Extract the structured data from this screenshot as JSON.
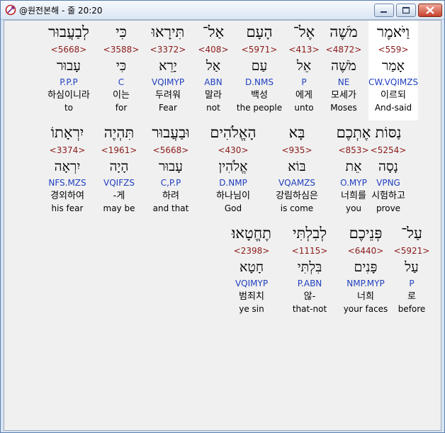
{
  "window": {
    "title": "@원전본해 - 줄 20:20"
  },
  "rows": [
    [
      {
        "heb": "וַיֹּאמֶר",
        "num": "<559>",
        "lemma": "אָמַר",
        "code": "CW.VQIMZS",
        "kor": "이르되",
        "eng": "And-said",
        "highlight": true
      },
      {
        "heb": "מֹשֶׁה",
        "num": "<4872>",
        "lemma": "מֹשֶׁה",
        "code": "NE",
        "kor": "모세가",
        "eng": "Moses"
      },
      {
        "heb": "אֶל־",
        "num": "<413>",
        "lemma": "אֵל",
        "code": "P",
        "kor": "에게",
        "eng": "unto"
      },
      {
        "heb": "הָעָם",
        "num": "<5971>",
        "lemma": "עַם",
        "code": "D.NMS",
        "kor": "백성",
        "eng": "the people"
      },
      {
        "heb": "אַל־",
        "num": "<408>",
        "lemma": "אַל",
        "code": "ABN",
        "kor": "말라",
        "eng": "not"
      },
      {
        "heb": "תִּירָאוּ",
        "num": "<3372>",
        "lemma": "יָרֵא",
        "code": "VQIMYP",
        "kor": "두려워",
        "eng": "Fear"
      },
      {
        "heb": "כִּי",
        "num": "<3588>",
        "lemma": "כִּי",
        "code": "C",
        "kor": "이는",
        "eng": "for"
      },
      {
        "heb": "לְבַעֲבוּר",
        "num": "<5668>",
        "lemma": "עָבוּר",
        "code": "P.P.P",
        "kor": "하심이니라",
        "eng": "to"
      }
    ],
    [
      {
        "heb": "נַסּוֹת",
        "num": "<5254>",
        "lemma": "נָסָה",
        "code": "VPNG",
        "kor": "시험하고",
        "eng": "prove"
      },
      {
        "heb": "אֶתְכֶם",
        "num": "<853>",
        "lemma": "אֵת",
        "code": "O.MYP",
        "kor": "너희를",
        "eng": "you"
      },
      {
        "heb": "בָּא",
        "num": "<935>",
        "lemma": "בּוֹא",
        "code": "VQAMZS",
        "kor": "강림하심은",
        "eng": "is come"
      },
      {
        "heb": "הָאֱלֹהִים",
        "num": "<430>",
        "lemma": "אֱלֹהִין",
        "code": "D.NMP",
        "kor": "하나님이",
        "eng": "God"
      },
      {
        "heb": "וּבַעֲבוּר",
        "num": "<5668>",
        "lemma": "עָבוּר",
        "code": "C,P.P",
        "kor": "하려",
        "eng": "and that"
      },
      {
        "heb": "תִּהְיֶה",
        "num": "<1961>",
        "lemma": "הָיָה",
        "code": "VQIFZS",
        "kor": "-게",
        "eng": "may be"
      },
      {
        "heb": "יִרְאָתוֹ",
        "num": "<3374>",
        "lemma": "יִרְאָה",
        "code": "NFS.MZS",
        "kor": "경외하여",
        "eng": "his fear"
      }
    ],
    [
      {
        "heb": "עַל־",
        "num": "<5921>",
        "lemma": "עַל",
        "code": "P",
        "kor": "로",
        "eng": "before"
      },
      {
        "heb": "פְּנֵיכֶם",
        "num": "<6440>",
        "lemma": "פָּנִים",
        "code": "NMP.MYP",
        "kor": "너희",
        "eng": "your faces"
      },
      {
        "heb": "לְבִלְתִּי",
        "num": "<1115>",
        "lemma": "בִּלְתִּי",
        "code": "P.ABN",
        "kor": "않-",
        "eng": "that-not"
      },
      {
        "heb": "תֶחֱטָאוּ׃",
        "num": "<2398>",
        "lemma": "חָטָא",
        "code": "VQIMYP",
        "kor": "범죄치",
        "eng": "ye sin"
      }
    ]
  ]
}
